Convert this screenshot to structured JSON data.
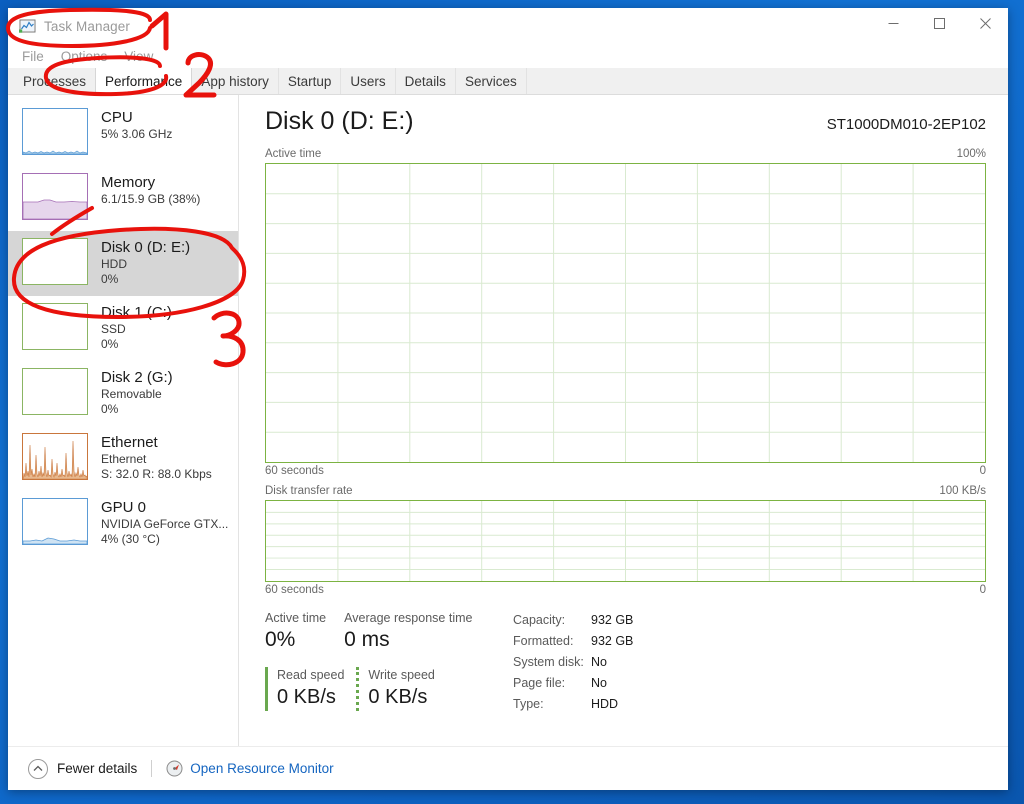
{
  "window": {
    "title": "Task Manager",
    "app_icon": "task-manager-icon",
    "controls": {
      "minimize": "minimize-icon",
      "maximize": "maximize-icon",
      "close": "close-icon"
    }
  },
  "menu": {
    "items": [
      {
        "label": "File"
      },
      {
        "label": "Options"
      },
      {
        "label": "View"
      }
    ]
  },
  "tabs": [
    {
      "label": "Processes",
      "active": false
    },
    {
      "label": "Performance",
      "active": true
    },
    {
      "label": "App history",
      "active": false
    },
    {
      "label": "Startup",
      "active": false
    },
    {
      "label": "Users",
      "active": false
    },
    {
      "label": "Details",
      "active": false
    },
    {
      "label": "Services",
      "active": false
    }
  ],
  "sidebar": {
    "items": [
      {
        "name": "CPU",
        "sub": "5%  3.06 GHz",
        "value": "",
        "color": "#4a90c4",
        "selected": false
      },
      {
        "name": "Memory",
        "sub": "6.1/15.9 GB (38%)",
        "value": "",
        "color": "#a56fb5",
        "selected": false
      },
      {
        "name": "Disk 0 (D: E:)",
        "sub": "HDD",
        "value": "0%",
        "color": "#8bb563",
        "selected": true
      },
      {
        "name": "Disk 1 (C:)",
        "sub": "SSD",
        "value": "0%",
        "color": "#8bb563",
        "selected": false
      },
      {
        "name": "Disk 2 (G:)",
        "sub": "Removable",
        "value": "0%",
        "color": "#8bb563",
        "selected": false
      },
      {
        "name": "Ethernet",
        "sub": "Ethernet",
        "value": "S: 32.0 R: 88.0 Kbps",
        "color": "#c9763c",
        "selected": false
      },
      {
        "name": "GPU 0",
        "sub": "NVIDIA GeForce GTX...",
        "value": "4%  (30 °C)",
        "color": "#5b9bd5",
        "selected": false
      }
    ]
  },
  "main": {
    "title": "Disk 0 (D: E:)",
    "model": "ST1000DM010-2EP102",
    "graph_active": {
      "label": "Active time",
      "max_label": "100%",
      "time_label": "60 seconds",
      "min_label": "0"
    },
    "graph_rate": {
      "label": "Disk transfer rate",
      "max_label": "100 KB/s",
      "time_label": "60 seconds",
      "min_label": "0"
    },
    "stats": {
      "active_time": {
        "caption": "Active time",
        "value": "0%"
      },
      "avg_response": {
        "caption": "Average response time",
        "value": "0 ms"
      },
      "read_speed": {
        "caption": "Read speed",
        "value": "0 KB/s"
      },
      "write_speed": {
        "caption": "Write speed",
        "value": "0 KB/s"
      }
    },
    "properties": [
      {
        "key": "Capacity:",
        "value": "932 GB"
      },
      {
        "key": "Formatted:",
        "value": "932 GB"
      },
      {
        "key": "System disk:",
        "value": "No"
      },
      {
        "key": "Page file:",
        "value": "No"
      },
      {
        "key": "Type:",
        "value": "HDD"
      }
    ]
  },
  "statusbar": {
    "fewer_details": "Fewer details",
    "fewer_details_icon": "chevron-up-circle-icon",
    "resource_monitor": "Open Resource Monitor",
    "resource_monitor_icon": "resource-monitor-icon"
  },
  "annotations": {
    "color": "#e8120c",
    "marks": [
      {
        "label": "1",
        "target": "title-bar"
      },
      {
        "label": "2",
        "target": "performance-tab"
      },
      {
        "label": "3",
        "target": "disk-0-sidebar-item"
      }
    ]
  },
  "chart_data": [
    {
      "type": "line",
      "title": "Active time",
      "ylabel": "",
      "xlabel": "60 seconds",
      "ylim": [
        0,
        100
      ],
      "y_max_label": "100%",
      "y_min_label": "0",
      "grid": true,
      "series": [
        {
          "name": "Active time",
          "values": [
            0,
            0,
            0,
            0,
            0,
            0,
            0,
            0,
            0,
            0,
            0,
            0,
            0,
            0,
            0,
            0,
            0,
            0,
            0,
            0,
            0,
            0,
            0,
            0,
            0,
            0,
            0,
            0,
            0,
            0,
            0,
            0,
            0,
            0,
            0,
            0,
            0,
            0,
            0,
            0,
            0,
            0,
            0,
            0,
            0,
            0,
            0,
            0,
            0,
            0,
            0,
            0,
            0,
            0,
            0,
            0,
            0,
            0,
            0,
            0
          ]
        }
      ]
    },
    {
      "type": "line",
      "title": "Disk transfer rate",
      "ylabel": "",
      "xlabel": "60 seconds",
      "ylim": [
        0,
        100
      ],
      "y_max_label": "100 KB/s",
      "y_min_label": "0",
      "grid": true,
      "series": [
        {
          "name": "Disk transfer rate",
          "values": [
            0,
            0,
            0,
            0,
            0,
            0,
            0,
            0,
            0,
            0,
            0,
            0,
            0,
            0,
            0,
            0,
            0,
            0,
            0,
            0,
            0,
            0,
            0,
            0,
            0,
            0,
            0,
            0,
            0,
            0,
            0,
            0,
            0,
            0,
            0,
            0,
            0,
            0,
            0,
            0,
            0,
            0,
            0,
            0,
            0,
            0,
            0,
            0,
            0,
            0,
            0,
            0,
            0,
            0,
            0,
            0,
            0,
            0,
            0,
            0
          ]
        }
      ]
    }
  ]
}
